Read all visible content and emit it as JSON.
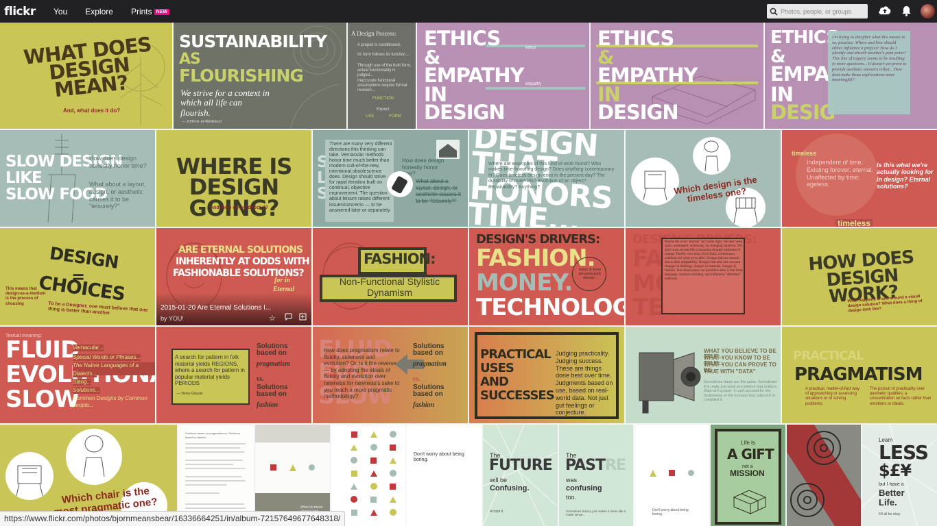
{
  "header": {
    "logo": "flickr",
    "nav": [
      "You",
      "Explore",
      "Prints"
    ],
    "prints_badge": "NEW",
    "search_placeholder": "Photos, people, or groups"
  },
  "tiles": {
    "t1": {
      "title": "WHAT DOES DESIGN MEAN?",
      "sub": "And, what does it do?"
    },
    "t2": {
      "l1": "SUSTAINABILITY",
      "l2": "AS",
      "l3": "FLOURISHING",
      "body": "We strive for a context in which all life can flourish.",
      "credit": "— JOHN R. EHRENFELD"
    },
    "t3": {
      "head": "A Design Process:",
      "p1": "A project is conditioned.",
      "p2": "Its form follows its function...",
      "p3": "Through use of the built form, actual functionality is judged...",
      "p4": "Inaccurate functional assumptions require formal revision...",
      "l1": "FUNCTION",
      "l2": "Expect",
      "l3": "USE",
      "l4": "FORM"
    },
    "t4": {
      "l1": "ETHICS",
      "l2": "&",
      "l3": "EMPATHY",
      "l4": "IN",
      "l5": "DESIGN",
      "k1": "ethics",
      "k2": "empathy"
    },
    "t5": {
      "l1": "ETHICS",
      "l2": "&",
      "l3": "EMPATHY",
      "l4": "IN",
      "l5": "DESIGN"
    },
    "t6": {
      "l1": "ETHICS",
      "l2": "&",
      "l3": "EMPA",
      "l4": "IN",
      "l5": "DESIG",
      "body": "I'm trying to decipher what this means in my practice. Where and how should ethics influence a project? How do I identify and absorb another's pain point? This line of inquiry seems to be resulting in more questions... It doesn't yet prove to provide aesthetic answers either... How dont make those explorations more meaningful?"
    },
    "t7": {
      "l1": "SLOW DESIGN",
      "l2": "LIKE",
      "l3": "SLOW FOOD",
      "q1": "How does design honestly honor time?",
      "q2": "What about a layout, design, or aesthetic causes it to be \"leisurely?\""
    },
    "t8": {
      "title": "WHERE IS DESIGN GOING?",
      "sub": "And, how do we direct it?"
    },
    "t9": {
      "body": "There are many very different directions this thinking can take. Vernacular methods honor time much better than modern cult-of-the-new, intentional obsolescence does. Design should strive for rapid iteration built on continual, objective improvement. The question about leisure raises different issues/concerns — to be answered later or separately.",
      "q": "How does design honestly honor time?",
      "q2": "What about a layout, design, or aesthetic causes it to be \"leisurely?\""
    },
    "t10": {
      "title": "DESIGN THAT HONORS TIME...",
      "body": "Where are examples of this kind of work found? Who makes time-honoring design? Does anything contemporary fit? Does timeless design exist in the present-day? The durability of materials? Evolution of an object? Repairability? Anything?"
    },
    "t11": {
      "q": "Which design is the timeless one?"
    },
    "t12": {
      "w": "timeless",
      "d": "Independent of time. Existing forever; eternal. Unaffected by time; ageless.",
      "q": "Is this what we're actually looking for in design? Eternal solutions?",
      "tag": "timeless"
    },
    "t13": {
      "l1": "DESIGN",
      "l2": "=",
      "l3": "CHOICES",
      "small": "This means that design-as-a-medium is the process of choosing",
      "sub": "To be a Designer, one must believe that one thing is better than another"
    },
    "t14": {
      "l1": "ARE ETERNAL SOLUTIONS",
      "l2": "INHERENTLY AT ODDS WITH",
      "l3": "FASHIONABLE SOLUTIONS?",
      "side": "for in",
      "side2": "Eternal",
      "ov_title": "2015-01-20 Are Eternal Solutions I...",
      "ov_by": "by YOU!"
    },
    "t15": {
      "l1": "FASHION:",
      "l2": "Non-Functional Stylistic",
      "l3": "Dynamism"
    },
    "t16": {
      "head": "DESIGN'S DRIVERS:",
      "l1": "FASHION.",
      "l2": "MONEY.",
      "l3": "TECHNOLOGY.",
      "circle": "Some of these are particularly eternal..."
    },
    "t17": {
      "head": "DESIGN'S DRIVERS:",
      "body": "Maybe the word \"eternal\" isn't quite right. We don't seek static, permanent, unmoving, un-changing solutions. We don't want eternal like a mountain through millennia of change. Fluidly over time. Even fluid, evolutionary solutions are what we're after. Designs that are eternal due to their adaptability. Designs that take into account changes in thinking, changes in material, changes in fashion. The timelessness we should be after is that from language, common building, and millennial \"effortless\" solutions."
    },
    "t18": {
      "title": "HOW DOES DESIGN WORK?",
      "sub": "What happens in and around a visual design solution? What does a thing of design look like?"
    },
    "t19": {
      "head": "Textual meaning:",
      "l1": "FLUID",
      "l2": "EVOLUTIONARY",
      "l3": "SLOW",
      "items": [
        "Vernacular...",
        "Special Words or Phrases...",
        "The Native Languages of a place...",
        "Dialects...",
        "Slang...",
        "Solutions...",
        "Common Designs by Common people..."
      ]
    },
    "t20": {
      "box": "A search for pattern in folk material yields REGIONS, where a search for pattern in popular material yields PERIODS",
      "credit": "— Henry Glassie",
      "r1": "Solutions based on",
      "r1b": "pragmatism",
      "r2": "vs.",
      "r3": "Solutions based on",
      "r3b": "fashion"
    },
    "t21": {
      "body": "How does pragmatism relate to fluidity, slowness and evolution? Or, is it the reverse — by adopting the ideals of fluidity and evolution over newness for newness's sake to you reach a more pragmatic methodology?",
      "r1": "Solutions based on",
      "r1b": "pragmatism",
      "r2": "vs.",
      "r3": "Solutions based on",
      "r3b": "fashion"
    },
    "t22": {
      "l1": "PRACTICAL",
      "l2": "USES",
      "l3": "AND",
      "l4": "SUCCESSES",
      "body": "Judging practicality. Judging success. These are things done best over time. Judgments based on use, based on real-world data. Not just gut feelings or conjecture."
    },
    "t23": {
      "l1": "WHAT YOU BELIEVE TO BE TRUE...",
      "l2": "WHAT YOU KNOW TO BE TRUE...",
      "l3": "WHAT YOU CAN PROVE TO BE",
      "l4": "TRUE WITH \"DATA\"",
      "body": "Sometimes these are the same. Sometimes it is really just what you believe that matters. Data isn't gospel. It can't account for the foolishness of the humans that collected or compiled it."
    },
    "t24": {
      "title": "PRAGMATISM",
      "d1": "A practical, matter-of-fact way of approaching or assessing situations or of solving problems.",
      "d2": "The pursuit of practicality over aesthetic qualities; a concentration on facts rather than emotions or ideals."
    },
    "t25": {
      "q1": "Which chair is the",
      "q2": "most pragmatic one?"
    },
    "t26": {
      "text": "Solutions based on pragmatism vs. Solutions based on fashion"
    },
    "t27": {
      "q": "What do these shapes and colors say?"
    },
    "t29": {
      "text": "Don't worry about being boring."
    },
    "t30": {
      "l1": "The",
      "l2": "FUTURE",
      "l3": "will be",
      "l4": "Confusing.",
      "f": "Accept it."
    },
    "t31": {
      "l1": "The",
      "l2": "PAST",
      "l2b": "RE",
      "l3": "was",
      "l4": "confusing",
      "l5": "too.",
      "f": "Sometimes history just makes it seem like it made sense..."
    },
    "t32": {
      "text": "Don't worry about being boring."
    },
    "t33": {
      "l1": "Life is",
      "l2": "A GIFT",
      "l3": "not a",
      "l4": "MISSION"
    },
    "t35": {
      "l1": "Learn",
      "l2": "LESS",
      "l3": "$£¥",
      "l4": "but I have a",
      "l5": "Better",
      "l6": "Life.",
      "f": "It'll all be okay."
    }
  },
  "status_url": "https://www.flickr.com/photos/bjornmeansbear/16336664251/in/album-72157649677648318/"
}
